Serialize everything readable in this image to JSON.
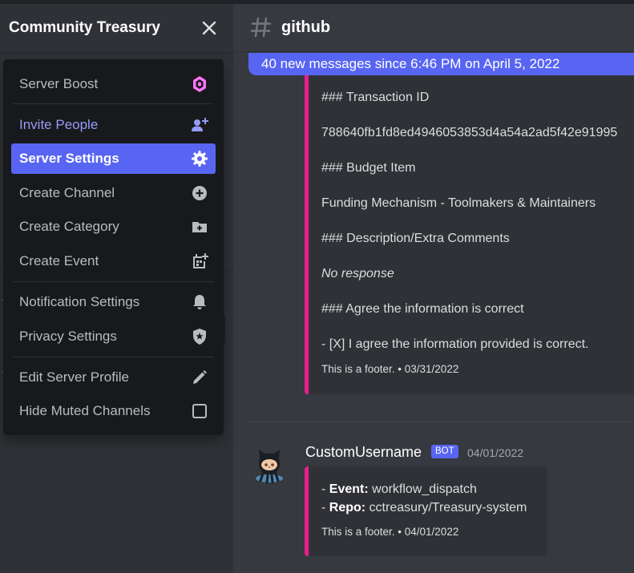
{
  "server": {
    "name": "Community Treasury"
  },
  "menu": {
    "items": [
      {
        "label": "Server Boost",
        "icon": "boost-gem-icon"
      },
      {
        "label": "Invite People",
        "icon": "add-user-icon"
      },
      {
        "label": "Server Settings",
        "icon": "gear-icon"
      },
      {
        "label": "Create Channel",
        "icon": "plus-circle-icon"
      },
      {
        "label": "Create Category",
        "icon": "folder-plus-icon"
      },
      {
        "label": "Create Event",
        "icon": "calendar-plus-icon"
      },
      {
        "label": "Notification Settings",
        "icon": "bell-icon"
      },
      {
        "label": "Privacy Settings",
        "icon": "shield-star-icon"
      },
      {
        "label": "Edit Server Profile",
        "icon": "pencil-icon"
      },
      {
        "label": "Hide Muted Channels",
        "icon": "checkbox-icon"
      }
    ]
  },
  "channel": {
    "name": "github"
  },
  "new_messages": {
    "text": "40 new messages since 6:46 PM on April 5, 2022"
  },
  "embed1": {
    "lines": [
      "### Transaction ID",
      "788640fb1fd8ed4946053853d4a54a2ad5f42e91995",
      "### Budget Item",
      "Funding Mechanism - Toolmakers & Maintainers",
      "### Description/Extra Comments",
      "No response",
      "### Agree the information is correct",
      "- [X] I agree the information provided is correct."
    ],
    "footer": "This is a footer. • 03/31/2022"
  },
  "message": {
    "author": "CustomUsername",
    "badge": "BOT",
    "timestamp": "04/01/2022",
    "event_label": "Event:",
    "event_value": " workflow_dispatch",
    "repo_label": "Repo:",
    "repo_value": " cctreasury/Treasury-system",
    "bullet": "- ",
    "footer": "This is a footer. • 04/01/2022"
  },
  "colors": {
    "accent": "#5865f2",
    "embed_border": "#e91e8c",
    "invite": "#949cf7",
    "boost": "#ff73fa"
  }
}
